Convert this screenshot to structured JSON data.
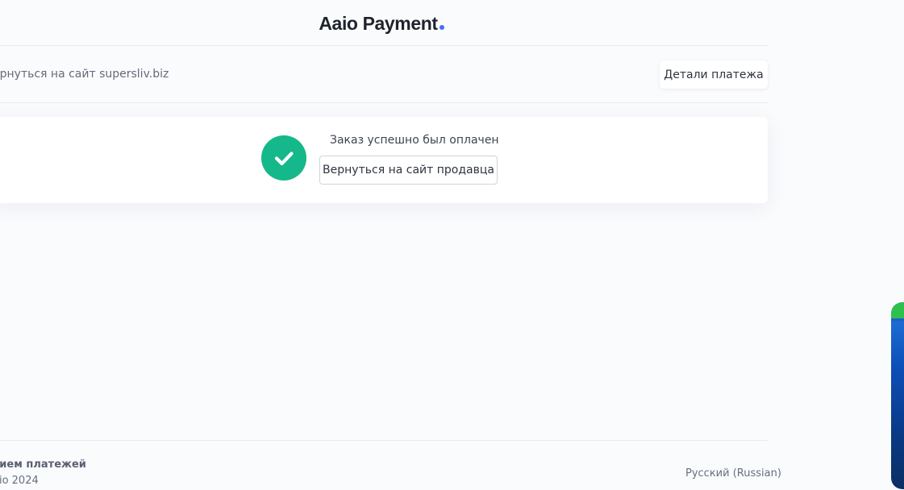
{
  "header": {
    "brand": "Aaio Payment",
    "brand_dot_color": "#4a6cf7"
  },
  "nav": {
    "back_link": "ернуться на сайт supersliv.biz",
    "details_button": "Детали платежа"
  },
  "status": {
    "icon": "check-icon",
    "color": "#14b88a",
    "message": "Заказ успешно был оплачен",
    "return_button": "Вернуться на сайт продавца"
  },
  "footer": {
    "title": "рием платежей",
    "copyright": "aio 2024",
    "language": "Русский (Russian)"
  },
  "side_widget": {
    "icon": "side-widget-icon"
  }
}
